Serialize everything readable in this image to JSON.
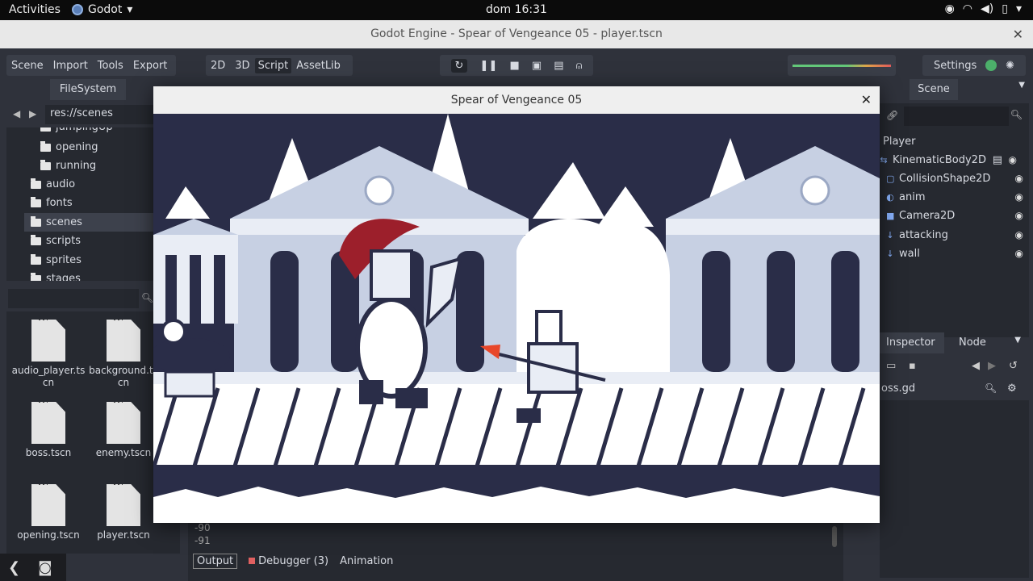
{
  "topbar": {
    "activities": "Activities",
    "app": "Godot",
    "clock": "dom 16:31"
  },
  "window": {
    "title": "Godot Engine - Spear of Vengeance 05 - player.tscn"
  },
  "menu": {
    "items": [
      "Scene",
      "Import",
      "Tools",
      "Export"
    ]
  },
  "workspaces": {
    "items": [
      "2D",
      "3D",
      "Script",
      "AssetLib"
    ],
    "active": "Script"
  },
  "settings": {
    "label": "Settings"
  },
  "filesystem": {
    "tab": "FileSystem",
    "path": "res://scenes",
    "tree": [
      {
        "name": "jumpingUp",
        "indent": 2
      },
      {
        "name": "opening",
        "indent": 2
      },
      {
        "name": "running",
        "indent": 2
      },
      {
        "name": "audio",
        "indent": 1
      },
      {
        "name": "fonts",
        "indent": 1
      },
      {
        "name": "scenes",
        "indent": 1,
        "selected": true
      },
      {
        "name": "scripts",
        "indent": 1
      },
      {
        "name": "sprites",
        "indent": 1
      },
      {
        "name": "stages",
        "indent": 1
      }
    ],
    "files": [
      "audio_player.tscn",
      "background.tscn",
      "boss.tscn",
      "enemy.tscn",
      "opening.tscn",
      "player.tscn"
    ]
  },
  "output": {
    "lines": [
      "-90",
      "-91"
    ],
    "tabs": [
      "Output",
      "Debugger (3)",
      "Animation"
    ]
  },
  "scene_dock": {
    "tab": "Scene",
    "nodes": [
      {
        "name": "Player",
        "icon": "root"
      },
      {
        "name": "KinematicBody2D",
        "icon": "body"
      },
      {
        "name": "CollisionShape2D",
        "icon": "shape"
      },
      {
        "name": "anim",
        "icon": "anim"
      },
      {
        "name": "Camera2D",
        "icon": "camera"
      },
      {
        "name": "attacking",
        "icon": "arrow"
      },
      {
        "name": "wall",
        "icon": "arrow"
      }
    ]
  },
  "inspector": {
    "tabs": [
      "Inspector",
      "Node"
    ],
    "resource": "oss.gd"
  },
  "game": {
    "title": "Spear of Vengeance 05",
    "colors": {
      "navy": "#2a2d48",
      "pale": "#c7d0e3",
      "white": "#ffffff",
      "red": "#9c1f2b",
      "flame": "#e8472a"
    }
  }
}
